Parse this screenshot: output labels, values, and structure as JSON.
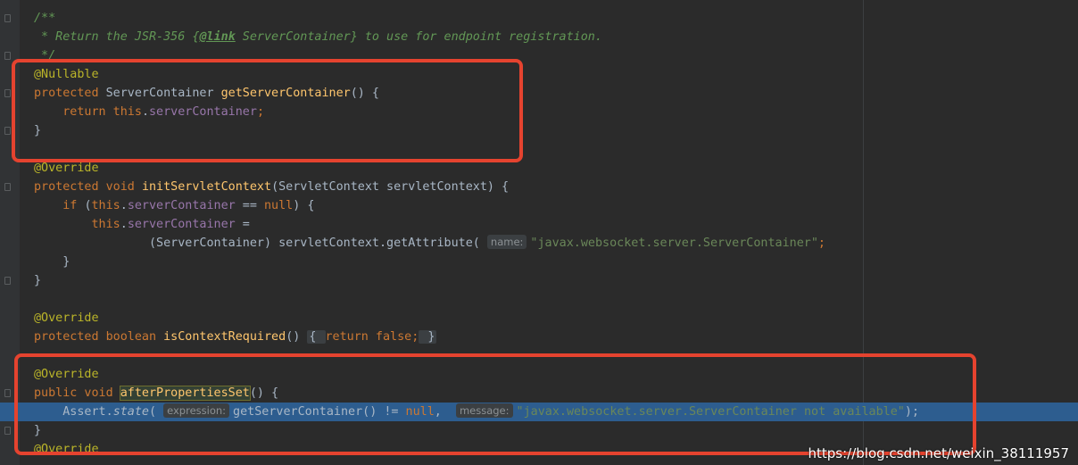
{
  "editor": {
    "lines": [
      {
        "id": "l1",
        "tokens": [
          [
            "comment",
            "/**"
          ]
        ]
      },
      {
        "id": "l2",
        "tokens": [
          [
            "comment",
            " * Return the JSR-356 {"
          ],
          [
            "doctag",
            "@link"
          ],
          [
            "comment",
            " ServerContainer} to use for endpoint registration."
          ]
        ]
      },
      {
        "id": "l3",
        "tokens": [
          [
            "comment",
            " */"
          ]
        ]
      },
      {
        "id": "l4",
        "tokens": [
          [
            "annotation",
            "@Nullable"
          ]
        ]
      },
      {
        "id": "l5",
        "tokens": [
          [
            "keyword",
            "protected "
          ],
          [
            "plain",
            "ServerContainer "
          ],
          [
            "method-decl",
            "getServerContainer"
          ],
          [
            "plain",
            "() {"
          ]
        ]
      },
      {
        "id": "l6",
        "tokens": [
          [
            "plain",
            "    "
          ],
          [
            "keyword",
            "return this"
          ],
          [
            "plain",
            "."
          ],
          [
            "field",
            "serverContainer"
          ],
          [
            "keyword",
            ";"
          ]
        ]
      },
      {
        "id": "l7",
        "tokens": [
          [
            "plain",
            "}"
          ]
        ]
      },
      {
        "id": "l8",
        "tokens": []
      },
      {
        "id": "l9",
        "tokens": [
          [
            "annotation",
            "@Override"
          ]
        ]
      },
      {
        "id": "l10",
        "tokens": [
          [
            "keyword",
            "protected void "
          ],
          [
            "method-decl",
            "initServletContext"
          ],
          [
            "plain",
            "(ServletContext servletContext) {"
          ]
        ]
      },
      {
        "id": "l11",
        "tokens": [
          [
            "plain",
            "    "
          ],
          [
            "keyword",
            "if "
          ],
          [
            "plain",
            "("
          ],
          [
            "keyword",
            "this"
          ],
          [
            "plain",
            "."
          ],
          [
            "field",
            "serverContainer"
          ],
          [
            "plain",
            " == "
          ],
          [
            "keyword",
            "null"
          ],
          [
            "plain",
            ") {"
          ]
        ]
      },
      {
        "id": "l12",
        "tokens": [
          [
            "plain",
            "        "
          ],
          [
            "keyword",
            "this"
          ],
          [
            "plain",
            "."
          ],
          [
            "field",
            "serverContainer"
          ],
          [
            "plain",
            " ="
          ]
        ]
      },
      {
        "id": "l13",
        "tokens": [
          [
            "plain",
            "                (ServerContainer) servletContext.getAttribute( "
          ],
          [
            "hint",
            "name:"
          ],
          [
            "string",
            "\"javax.websocket.server.ServerContainer\""
          ],
          [
            "keyword",
            ";"
          ]
        ]
      },
      {
        "id": "l14",
        "tokens": [
          [
            "plain",
            "    }"
          ]
        ]
      },
      {
        "id": "l15",
        "tokens": [
          [
            "plain",
            "}"
          ]
        ]
      },
      {
        "id": "l16",
        "tokens": []
      },
      {
        "id": "l17",
        "tokens": [
          [
            "annotation",
            "@Override"
          ]
        ]
      },
      {
        "id": "l18",
        "tokens": [
          [
            "keyword",
            "protected boolean "
          ],
          [
            "method-decl",
            "isContextRequired"
          ],
          [
            "plain",
            "() "
          ],
          [
            "fold-inline",
            "{ "
          ],
          [
            "keyword",
            "return false;"
          ],
          [
            "fold-inline",
            " }"
          ]
        ]
      },
      {
        "id": "l19",
        "tokens": []
      },
      {
        "id": "l20",
        "tokens": [
          [
            "annotation",
            "@Override"
          ]
        ]
      },
      {
        "id": "l21",
        "tokens": [
          [
            "keyword",
            "public void "
          ],
          [
            "method-decl-box",
            "afterPropertiesSet"
          ],
          [
            "plain",
            "() {"
          ]
        ]
      },
      {
        "id": "l22",
        "tokens": [
          [
            "plain",
            "    Assert."
          ],
          [
            "static",
            "state"
          ],
          [
            "plain",
            "( "
          ],
          [
            "hint",
            "expression:"
          ],
          [
            "plain",
            "getServerContainer() != "
          ],
          [
            "keyword",
            "null"
          ],
          [
            "plain",
            ",  "
          ],
          [
            "hint",
            "message:"
          ],
          [
            "string",
            "\"javax.websocket.server.ServerContainer not available\""
          ],
          [
            "plain",
            ");"
          ]
        ],
        "highlighted": true
      },
      {
        "id": "l23",
        "tokens": [
          [
            "plain",
            "}"
          ]
        ]
      },
      {
        "id": "l24",
        "tokens": [
          [
            "plain",
            ""
          ],
          [
            "annotation",
            "@Override"
          ]
        ]
      }
    ]
  },
  "watermark": "https://blog.csdn.net/weixin_38111957",
  "colors": {
    "background": "#2b2b2b",
    "highlight_row": "#2d5d8f",
    "annotation_box": "#e5432f",
    "keyword": "#cc7832",
    "string": "#6a8759",
    "comment": "#629755",
    "field": "#9876aa",
    "method": "#ffc66d",
    "annotation": "#bbb529"
  }
}
